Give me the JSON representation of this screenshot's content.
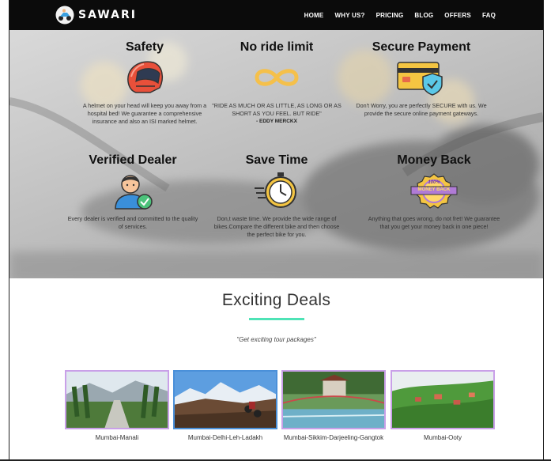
{
  "brand": {
    "name": "SAWARI"
  },
  "nav": {
    "items": [
      "HOME",
      "WHY US?",
      "PRICING",
      "BLOG",
      "OFFERS",
      "FAQ"
    ]
  },
  "features": [
    {
      "title": "Safety",
      "icon": "helmet-icon",
      "text": "A helmet on your head will keep you away from a hospital bed! We guarantee a comprehensive insurance and also an ISI marked helmet."
    },
    {
      "title": "No ride limit",
      "icon": "infinity-icon",
      "quote": "\"RIDE AS MUCH OR AS LITTLE, AS LONG OR AS SHORT AS YOU FEEL. BUT RIDE\"",
      "author": "- EDDY MERCKX"
    },
    {
      "title": "Secure Payment",
      "icon": "credit-card-shield-icon",
      "text": "Don't Worry, you are perfectly SECURE with us. We provide the secure online payment gateways."
    },
    {
      "title": "Verified Dealer",
      "icon": "verified-user-icon",
      "text": "Every dealer is verified and committed to the quality of services."
    },
    {
      "title": "Save Time",
      "icon": "stopwatch-icon",
      "text": "Don,t waste time. We provide the wide range of bikes.Compare the different bike and then choose the perfect bike for you."
    },
    {
      "title": "Money Back",
      "icon": "money-back-badge-icon",
      "badge_text": "100%",
      "badge_label": "MONEY BACK",
      "text": "Anything that goes wrong, do not fret! We guarantee that you get your money back in one piece!"
    }
  ],
  "deals": {
    "title": "Exciting Deals",
    "subtitle": "\"Get exciting tour packages\"",
    "packages": [
      {
        "name": "Mumbai-Manali"
      },
      {
        "name": "Mumbai-Delhi-Leh-Ladakh"
      },
      {
        "name": "Mumbai-Sikkim-Darjeeling-Gangtok"
      },
      {
        "name": "Mumbai-Ooty"
      }
    ]
  },
  "colors": {
    "accent": "#4ee3b6",
    "navbar": "#0b0b0b",
    "photo_border": "#c9a0e8"
  }
}
